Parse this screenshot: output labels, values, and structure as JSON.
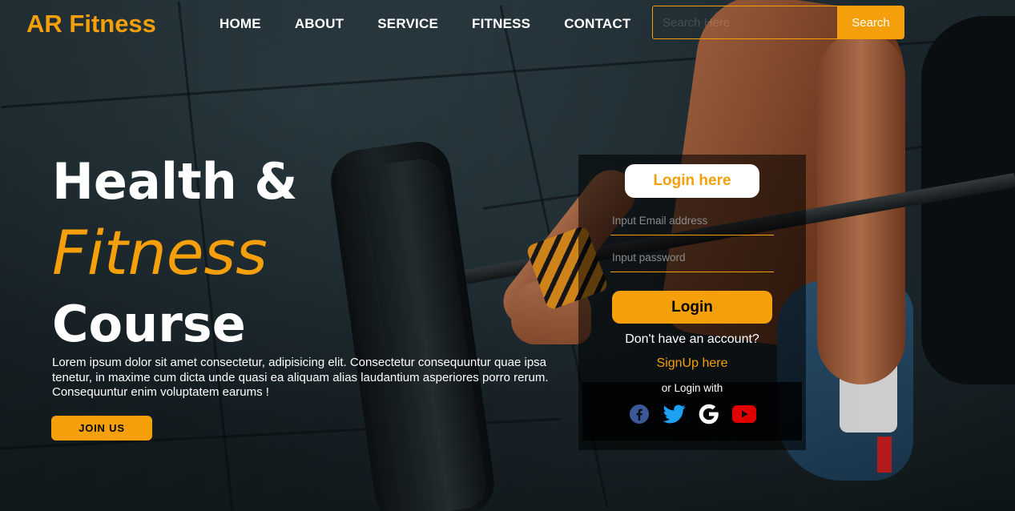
{
  "brand": {
    "logo_text": "AR Fitness",
    "accent_color": "#f5a00a"
  },
  "nav": {
    "items": [
      {
        "label": "HOME"
      },
      {
        "label": "ABOUT"
      },
      {
        "label": "SERVICE"
      },
      {
        "label": "FITNESS"
      },
      {
        "label": "CONTACT"
      }
    ]
  },
  "search": {
    "placeholder": "Search Here",
    "button_label": "Search"
  },
  "hero": {
    "line1": "Health &",
    "line2": "Fitness",
    "line3": "Course",
    "paragraph": "Lorem ipsum dolor sit amet consectetur, adipisicing elit. Consectetur consequuntur quae ipsa tenetur, in maxime cum dicta unde quasi ea aliquam alias laudantium asperiores porro rerum. Consequuntur enim voluptatem earums !",
    "join_label": "JOIN US"
  },
  "login": {
    "heading": "Login here",
    "email_placeholder": "Input Email address",
    "password_placeholder": "Input password",
    "button_label": "Login",
    "no_account_text": "Don't have an account?",
    "signup_label": "SignUp here",
    "or_login_with": "or Login with",
    "social_icons": [
      "facebook-icon",
      "twitter-icon",
      "google-icon",
      "youtube-icon"
    ],
    "social_colors": {
      "facebook": "#3b5998",
      "twitter": "#1da1f2",
      "google": "#ffffff",
      "youtube": "#e00000"
    }
  }
}
